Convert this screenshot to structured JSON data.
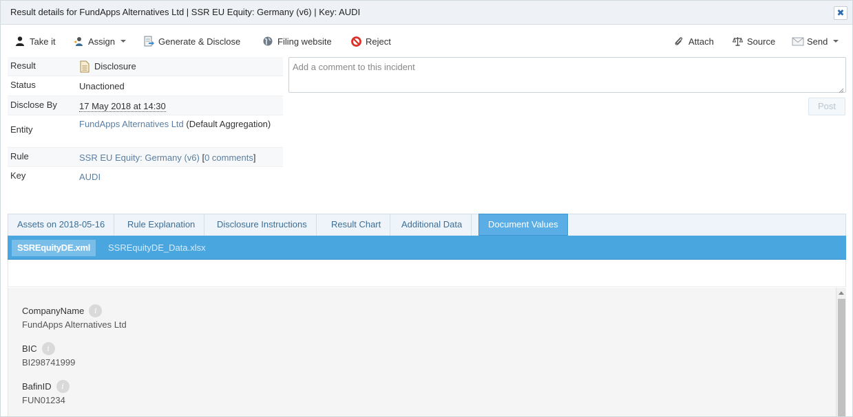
{
  "window": {
    "title": "Result details for FundApps Alternatives Ltd | SSR EU Equity: Germany (v6) | Key: AUDI",
    "close_glyph": "✖"
  },
  "toolbar": {
    "take_it": "Take it",
    "assign": "Assign",
    "generate_disclose": "Generate & Disclose",
    "filing_website": "Filing website",
    "reject": "Reject",
    "attach": "Attach",
    "source": "Source",
    "send": "Send"
  },
  "details": {
    "result": {
      "label": "Result",
      "value": "Disclosure"
    },
    "status": {
      "label": "Status",
      "value": "Unactioned"
    },
    "disclose_by": {
      "label": "Disclose By",
      "value": "17 May 2018 at 14:30"
    },
    "entity": {
      "label": "Entity",
      "link": "FundApps Alternatives Ltd",
      "suffix": " (Default Aggregation)"
    },
    "rule": {
      "label": "Rule",
      "link": "SSR EU Equity: Germany (v6)",
      "open_bracket": " [",
      "comments": "0 comments",
      "close_bracket": "]"
    },
    "key": {
      "label": "Key",
      "value": "AUDI"
    }
  },
  "comment": {
    "placeholder": "Add a comment to this incident",
    "post_label": "Post"
  },
  "tabs": [
    {
      "label": "Assets on 2018-05-16"
    },
    {
      "label": "Rule Explanation"
    },
    {
      "label": "Disclosure Instructions"
    },
    {
      "label": "Result Chart"
    },
    {
      "label": "Additional Data"
    },
    {
      "label": "Document Values",
      "active": true
    }
  ],
  "files": [
    {
      "label": "SSREquityDE.xml",
      "active": true
    },
    {
      "label": "SSREquityDE_Data.xlsx"
    }
  ],
  "document_values": [
    {
      "name": "CompanyName",
      "value": "FundApps Alternatives Ltd"
    },
    {
      "name": "BIC",
      "value": "BI298741999"
    },
    {
      "name": "BafinID",
      "value": "FUN01234"
    }
  ],
  "info_glyph": "i",
  "colors": {
    "tab_active": "#5aaee5",
    "file_bar": "#4aa6df",
    "link": "#5a7ea3",
    "reject_red": "#d9342b"
  }
}
